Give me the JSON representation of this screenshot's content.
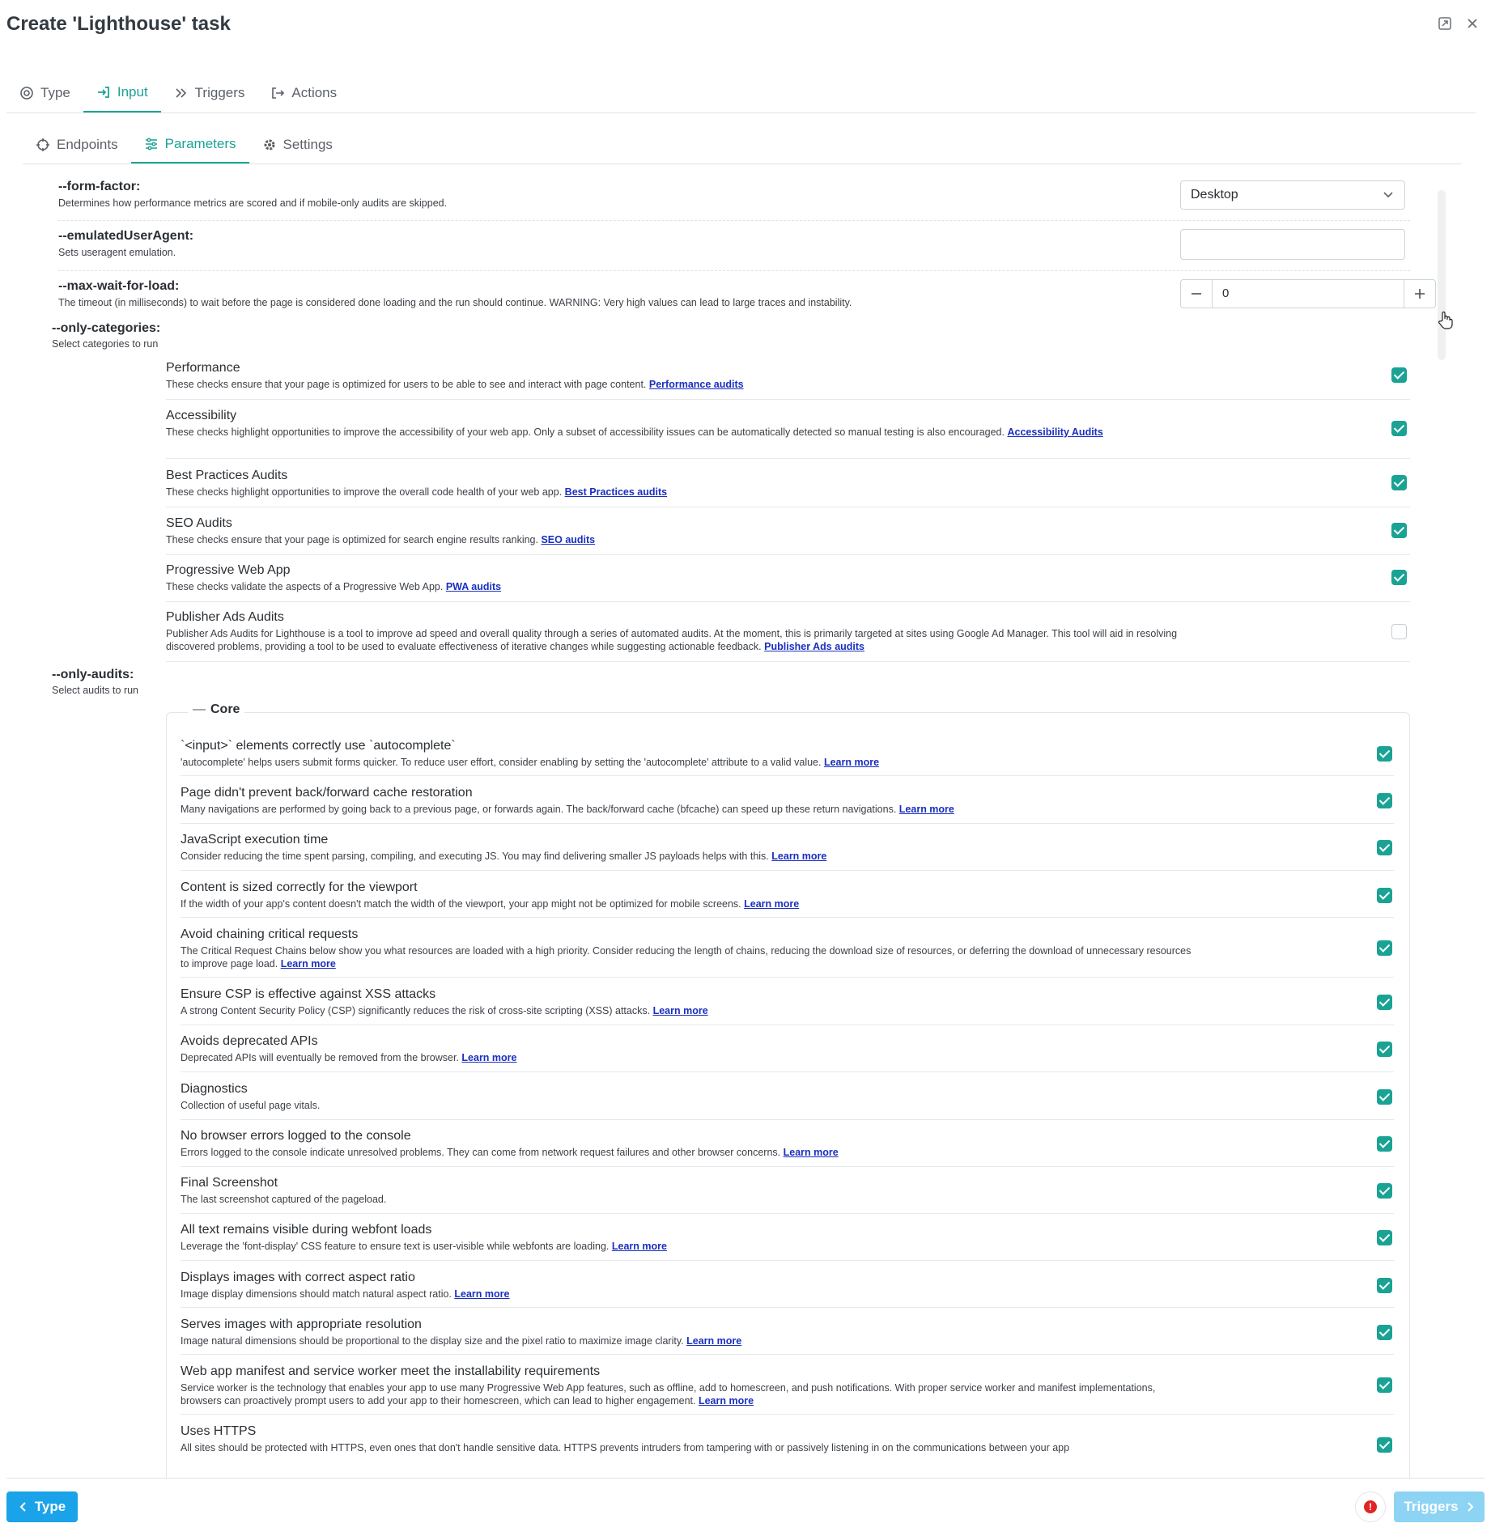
{
  "window": {
    "title": "Create 'Lighthouse' task"
  },
  "main_tabs": [
    {
      "label": "Type"
    },
    {
      "label": "Input"
    },
    {
      "label": "Triggers"
    },
    {
      "label": "Actions"
    }
  ],
  "sub_tabs": [
    {
      "label": "Endpoints"
    },
    {
      "label": "Parameters"
    },
    {
      "label": "Settings"
    }
  ],
  "params": {
    "form_factor": {
      "name": "--form-factor:",
      "desc": "Determines how performance metrics are scored and if mobile-only audits are skipped.",
      "value": "Desktop"
    },
    "emulated_user_agent": {
      "name": "--emulatedUserAgent:",
      "desc": "Sets useragent emulation.",
      "value": ""
    },
    "max_wait": {
      "name": "--max-wait-for-load:",
      "desc": "The timeout (in milliseconds) to wait before the page is considered done loading and the run should continue. WARNING: Very high values can lead to large traces and instability.",
      "value": "0"
    },
    "only_categories": {
      "name": "--only-categories:",
      "desc": "Select categories to run"
    },
    "only_audits": {
      "name": "--only-audits:",
      "desc": "Select audits to run"
    }
  },
  "categories": [
    {
      "title": "Performance",
      "desc": "These checks ensure that your page is optimized for users to be able to see and interact with page content.",
      "link": "Performance audits",
      "checked": true
    },
    {
      "title": "Accessibility",
      "desc": "These checks highlight opportunities to improve the accessibility of your web app. Only a subset of accessibility issues can be automatically detected so manual testing is also encouraged.",
      "link": "Accessibility Audits",
      "checked": true
    },
    {
      "title": "Best Practices Audits",
      "desc": "These checks highlight opportunities to improve the overall code health of your web app.",
      "link": "Best Practices audits",
      "checked": true
    },
    {
      "title": "SEO Audits",
      "desc": "These checks ensure that your page is optimized for search engine results ranking.",
      "link": "SEO audits",
      "checked": true
    },
    {
      "title": "Progressive Web App",
      "desc": "These checks validate the aspects of a Progressive Web App.",
      "link": "PWA audits",
      "checked": true
    },
    {
      "title": "Publisher Ads Audits",
      "desc": "Publisher Ads Audits for Lighthouse is a tool to improve ad speed and overall quality through a series of automated audits. At the moment, this is primarily targeted at sites using Google Ad Manager. This tool will aid in resolving discovered problems, providing a tool to be used to evaluate effectiveness of iterative changes while suggesting actionable feedback.",
      "link": "Publisher Ads audits",
      "checked": false
    }
  ],
  "audit_group": {
    "label": "Core"
  },
  "audits": [
    {
      "title": "`<input>` elements correctly use `autocomplete`",
      "desc": "'autocomplete' helps users submit forms quicker. To reduce user effort, consider enabling by setting the 'autocomplete' attribute to a valid value.",
      "link": "Learn more",
      "checked": true
    },
    {
      "title": "Page didn't prevent back/forward cache restoration",
      "desc": "Many navigations are performed by going back to a previous page, or forwards again. The back/forward cache (bfcache) can speed up these return navigations.",
      "link": "Learn more",
      "checked": true
    },
    {
      "title": "JavaScript execution time",
      "desc": "Consider reducing the time spent parsing, compiling, and executing JS. You may find delivering smaller JS payloads helps with this.",
      "link": "Learn more",
      "checked": true
    },
    {
      "title": "Content is sized correctly for the viewport",
      "desc": "If the width of your app's content doesn't match the width of the viewport, your app might not be optimized for mobile screens.",
      "link": "Learn more",
      "checked": true
    },
    {
      "title": "Avoid chaining critical requests",
      "desc": "The Critical Request Chains below show you what resources are loaded with a high priority. Consider reducing the length of chains, reducing the download size of resources, or deferring the download of unnecessary resources to improve page load.",
      "link": "Learn more",
      "checked": true
    },
    {
      "title": "Ensure CSP is effective against XSS attacks",
      "desc": "A strong Content Security Policy (CSP) significantly reduces the risk of cross-site scripting (XSS) attacks.",
      "link": "Learn more",
      "checked": true
    },
    {
      "title": "Avoids deprecated APIs",
      "desc": "Deprecated APIs will eventually be removed from the browser.",
      "link": "Learn more",
      "checked": true
    },
    {
      "title": "Diagnostics",
      "desc": "Collection of useful page vitals.",
      "link": "",
      "checked": true
    },
    {
      "title": "No browser errors logged to the console",
      "desc": "Errors logged to the console indicate unresolved problems. They can come from network request failures and other browser concerns.",
      "link": "Learn more",
      "checked": true
    },
    {
      "title": "Final Screenshot",
      "desc": "The last screenshot captured of the pageload.",
      "link": "",
      "checked": true
    },
    {
      "title": "All text remains visible during webfont loads",
      "desc": "Leverage the 'font-display' CSS feature to ensure text is user-visible while webfonts are loading.",
      "link": "Learn more",
      "checked": true
    },
    {
      "title": "Displays images with correct aspect ratio",
      "desc": "Image display dimensions should match natural aspect ratio.",
      "link": "Learn more",
      "checked": true
    },
    {
      "title": "Serves images with appropriate resolution",
      "desc": "Image natural dimensions should be proportional to the display size and the pixel ratio to maximize image clarity.",
      "link": "Learn more",
      "checked": true
    },
    {
      "title": "Web app manifest and service worker meet the installability requirements",
      "desc": "Service worker is the technology that enables your app to use many Progressive Web App features, such as offline, add to homescreen, and push notifications. With proper service worker and manifest implementations, browsers can proactively prompt users to add your app to their homescreen, which can lead to higher engagement.",
      "link": "Learn more",
      "checked": true
    },
    {
      "title": "Uses HTTPS",
      "desc": "All sites should be protected with HTTPS, even ones that don't handle sensitive data. HTTPS prevents intruders from tampering with or passively listening in on the communications between your app",
      "link": "",
      "checked": true
    }
  ],
  "footer": {
    "prev_label": "Type",
    "next_label": "Triggers",
    "error_mark": "!"
  },
  "colors": {
    "accent": "#1aa394",
    "primary_button": "#1aa3e8",
    "link": "#1a2fbf",
    "error": "#e02424"
  }
}
